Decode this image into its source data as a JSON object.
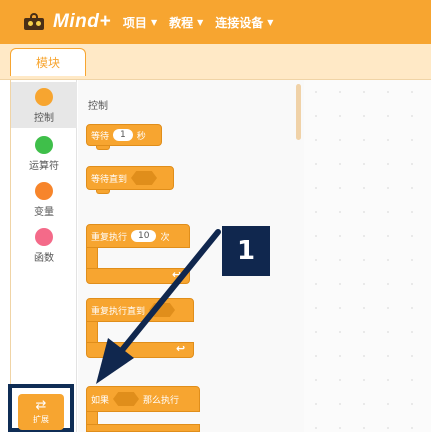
{
  "app": {
    "logo_text": "Mind+"
  },
  "menu": [
    {
      "label": "项目"
    },
    {
      "label": "教程"
    },
    {
      "label": "连接设备"
    }
  ],
  "tabs": [
    {
      "label": "模块"
    }
  ],
  "categories": [
    {
      "label": "控制",
      "color": "#f7a530",
      "active": true
    },
    {
      "label": "运算符",
      "color": "#3fbf4a",
      "active": false
    },
    {
      "label": "变量",
      "color": "#f7852b",
      "active": false
    },
    {
      "label": "函数",
      "color": "#f46a89",
      "active": false
    }
  ],
  "extension": {
    "label": "扩展",
    "icon": "extension-icon"
  },
  "palette": {
    "section_title": "控制",
    "blocks": {
      "wait": {
        "prefix": "等待",
        "value": "1",
        "suffix": "秒"
      },
      "wait_until": {
        "label": "等待直到"
      },
      "repeat": {
        "prefix": "重复执行",
        "value": "10",
        "suffix": "次"
      },
      "repeat_until": {
        "label": "重复执行直到"
      },
      "if_then": {
        "prefix": "如果",
        "suffix": "那么执行"
      }
    }
  },
  "annotation": {
    "number": "1",
    "color": "#10274e"
  },
  "colors": {
    "accent": "#f7a530",
    "topbar": "#f7a530"
  }
}
